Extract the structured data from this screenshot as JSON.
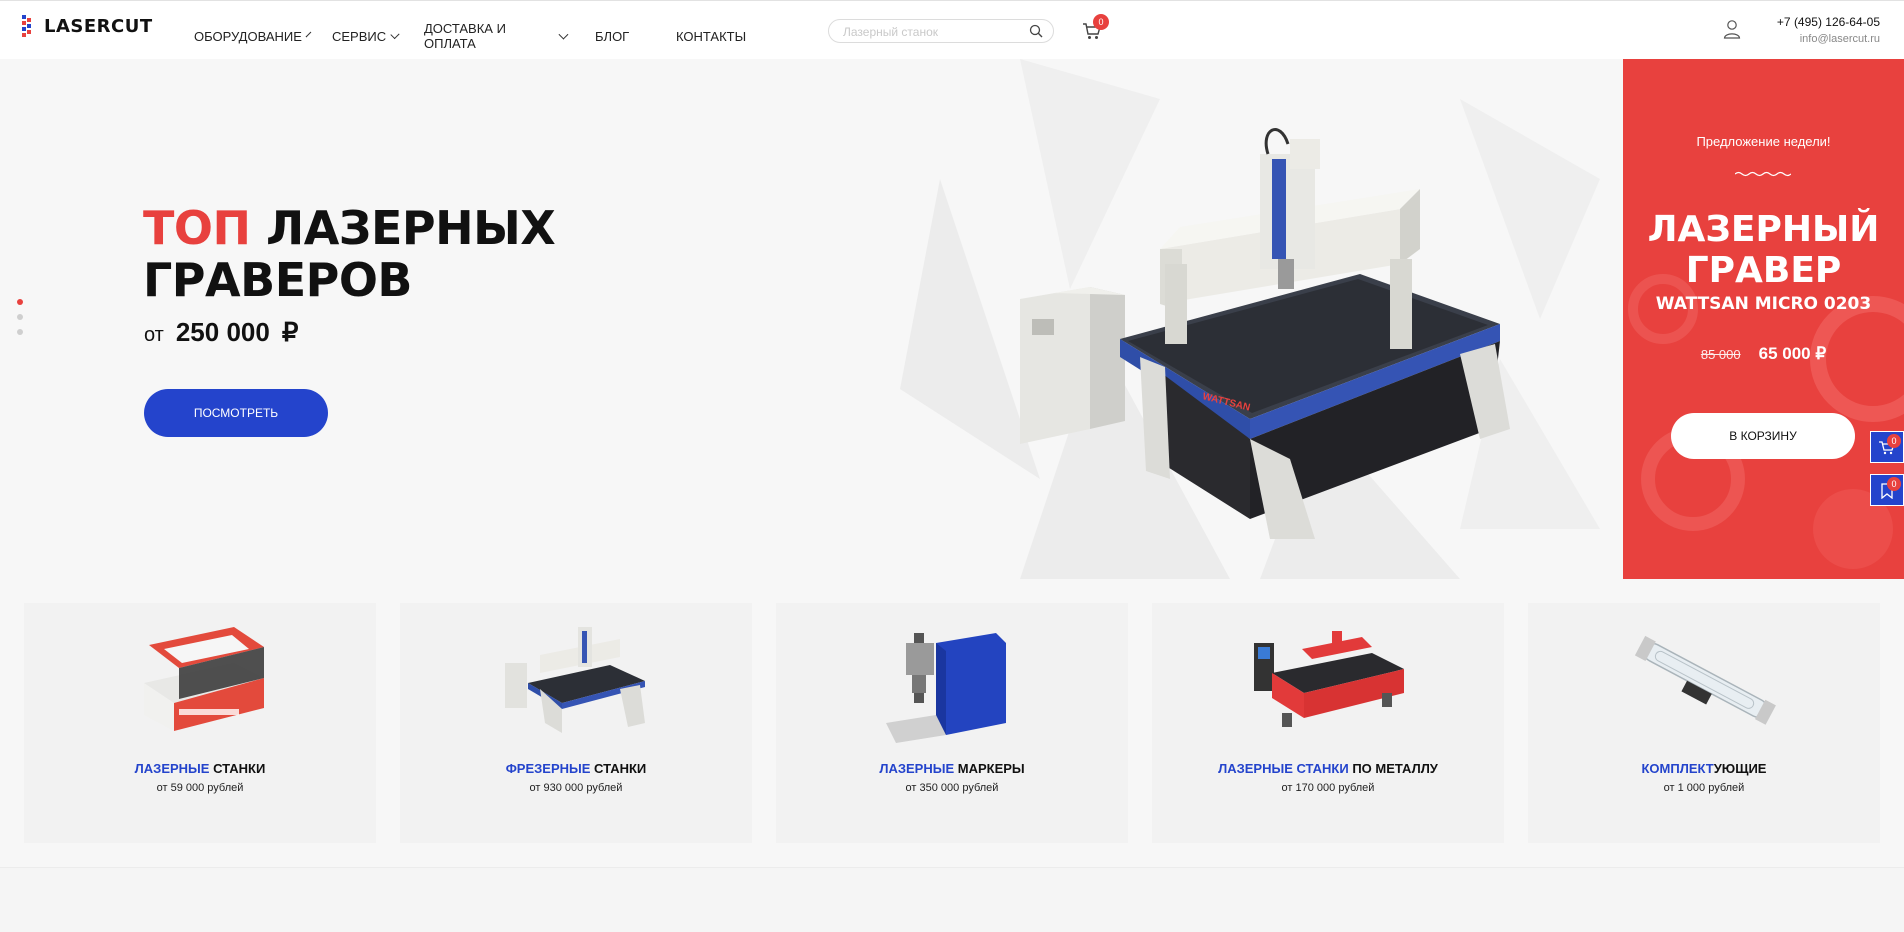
{
  "brand": {
    "logo_text": "LASERCUT",
    "accent": "#e8413e",
    "blue": "#2444cc"
  },
  "nav": {
    "items": [
      {
        "label": "ОБОРУДОВАНИЕ",
        "has_dropdown": true
      },
      {
        "label": "СЕРВИС",
        "has_dropdown": true
      },
      {
        "label": "ДОСТАВКА И ОПЛАТА",
        "has_dropdown": true
      },
      {
        "label": "БЛОГ",
        "has_dropdown": false
      },
      {
        "label": "КОНТАКТЫ",
        "has_dropdown": false
      }
    ]
  },
  "search": {
    "placeholder": "Лазерный станок",
    "value": "",
    "icon": "search-icon"
  },
  "cart": {
    "count": "0",
    "icon": "cart-icon"
  },
  "user": {
    "icon": "user-icon"
  },
  "contacts": {
    "phone": "+7 (495) 126-64-05",
    "email": "info@lasercut.ru"
  },
  "hero": {
    "title_accent": "ТОП",
    "title_rest_1": "ЛАЗЕРНЫХ",
    "title_rest_2": "ГРАВЕРОВ",
    "price_prefix": "от",
    "price_amount": "250 000",
    "currency": "₽",
    "button_label": "ПОСМОТРЕТЬ",
    "slides_total": 3,
    "active_slide": 1,
    "machine_brand": "WATTSAN"
  },
  "offer": {
    "tag": "Предложение недели!",
    "name_line1": "ЛАЗЕРНЫЙ",
    "name_line2": "ГРАВЕР",
    "model": "WATTSAN MICRO 0203",
    "old_price": "85 000",
    "new_price": "65 000 ₽",
    "button_label": "В КОРЗИНУ"
  },
  "side_widgets": [
    {
      "icon": "cart-icon",
      "count": "0"
    },
    {
      "icon": "bookmark-icon",
      "count": "0"
    }
  ],
  "categories": [
    {
      "title_blue": "ЛАЗЕРНЫЕ",
      "title_black": " СТАНКИ",
      "price": "от 59 000 рублей"
    },
    {
      "title_blue": "ФРЕЗЕРНЫЕ",
      "title_black": " СТАНКИ",
      "price": "от 930 000 рублей"
    },
    {
      "title_blue": "ЛАЗЕРНЫЕ",
      "title_black": " МАРКЕРЫ",
      "price": "от 350 000 рублей"
    },
    {
      "title_blue": "ЛАЗЕРНЫЕ СТАНКИ",
      "title_black": " ПО МЕТАЛЛУ",
      "price": "от 170 000 рублей"
    },
    {
      "title_blue": "КОМПЛЕКТ",
      "title_black": "УЮЩИЕ",
      "price": "от 1 000 рублей"
    }
  ]
}
